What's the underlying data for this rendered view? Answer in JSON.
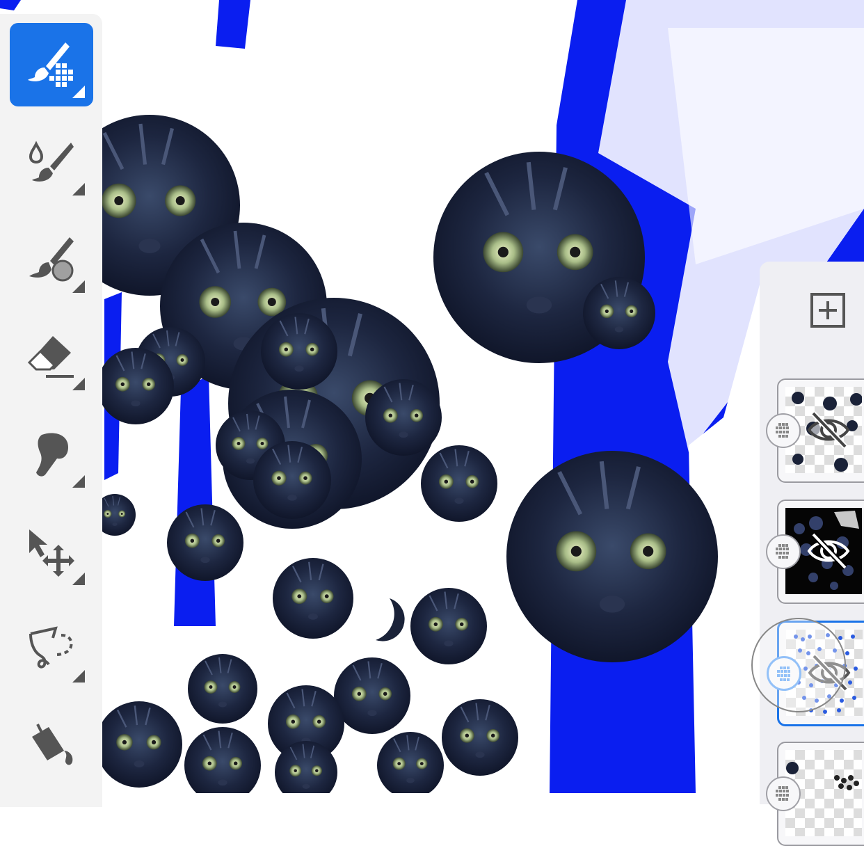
{
  "toolbar": {
    "tools": [
      {
        "name": "brush-pixel-tool",
        "icon": "brush-pixel-icon",
        "active": true
      },
      {
        "name": "blend-brush-tool",
        "icon": "smudge-brush-icon",
        "active": false
      },
      {
        "name": "paint-brush-tool",
        "icon": "paint-brush-icon",
        "active": false
      },
      {
        "name": "eraser-tool",
        "icon": "eraser-icon",
        "active": false
      },
      {
        "name": "smudge-tool",
        "icon": "finger-smudge-icon",
        "active": false
      },
      {
        "name": "move-tool",
        "icon": "move-arrow-icon",
        "active": false
      },
      {
        "name": "lasso-tool",
        "icon": "lasso-icon",
        "active": false
      },
      {
        "name": "fill-tool",
        "icon": "paint-bucket-icon",
        "active": false
      }
    ],
    "accent": "#1a73e8"
  },
  "layers_panel": {
    "add_icon": "plus-square-icon",
    "layers": [
      {
        "name": "layer-1",
        "visible": false,
        "selected": false
      },
      {
        "name": "layer-2",
        "visible": false,
        "selected": false
      },
      {
        "name": "layer-3",
        "visible": false,
        "selected": true
      },
      {
        "name": "layer-4",
        "visible": true,
        "selected": false
      }
    ]
  },
  "canvas": {
    "colors": {
      "blue": "#0a1ef0",
      "cat_dark": "#1a2238",
      "cat_eye": "#b8c89a"
    }
  }
}
